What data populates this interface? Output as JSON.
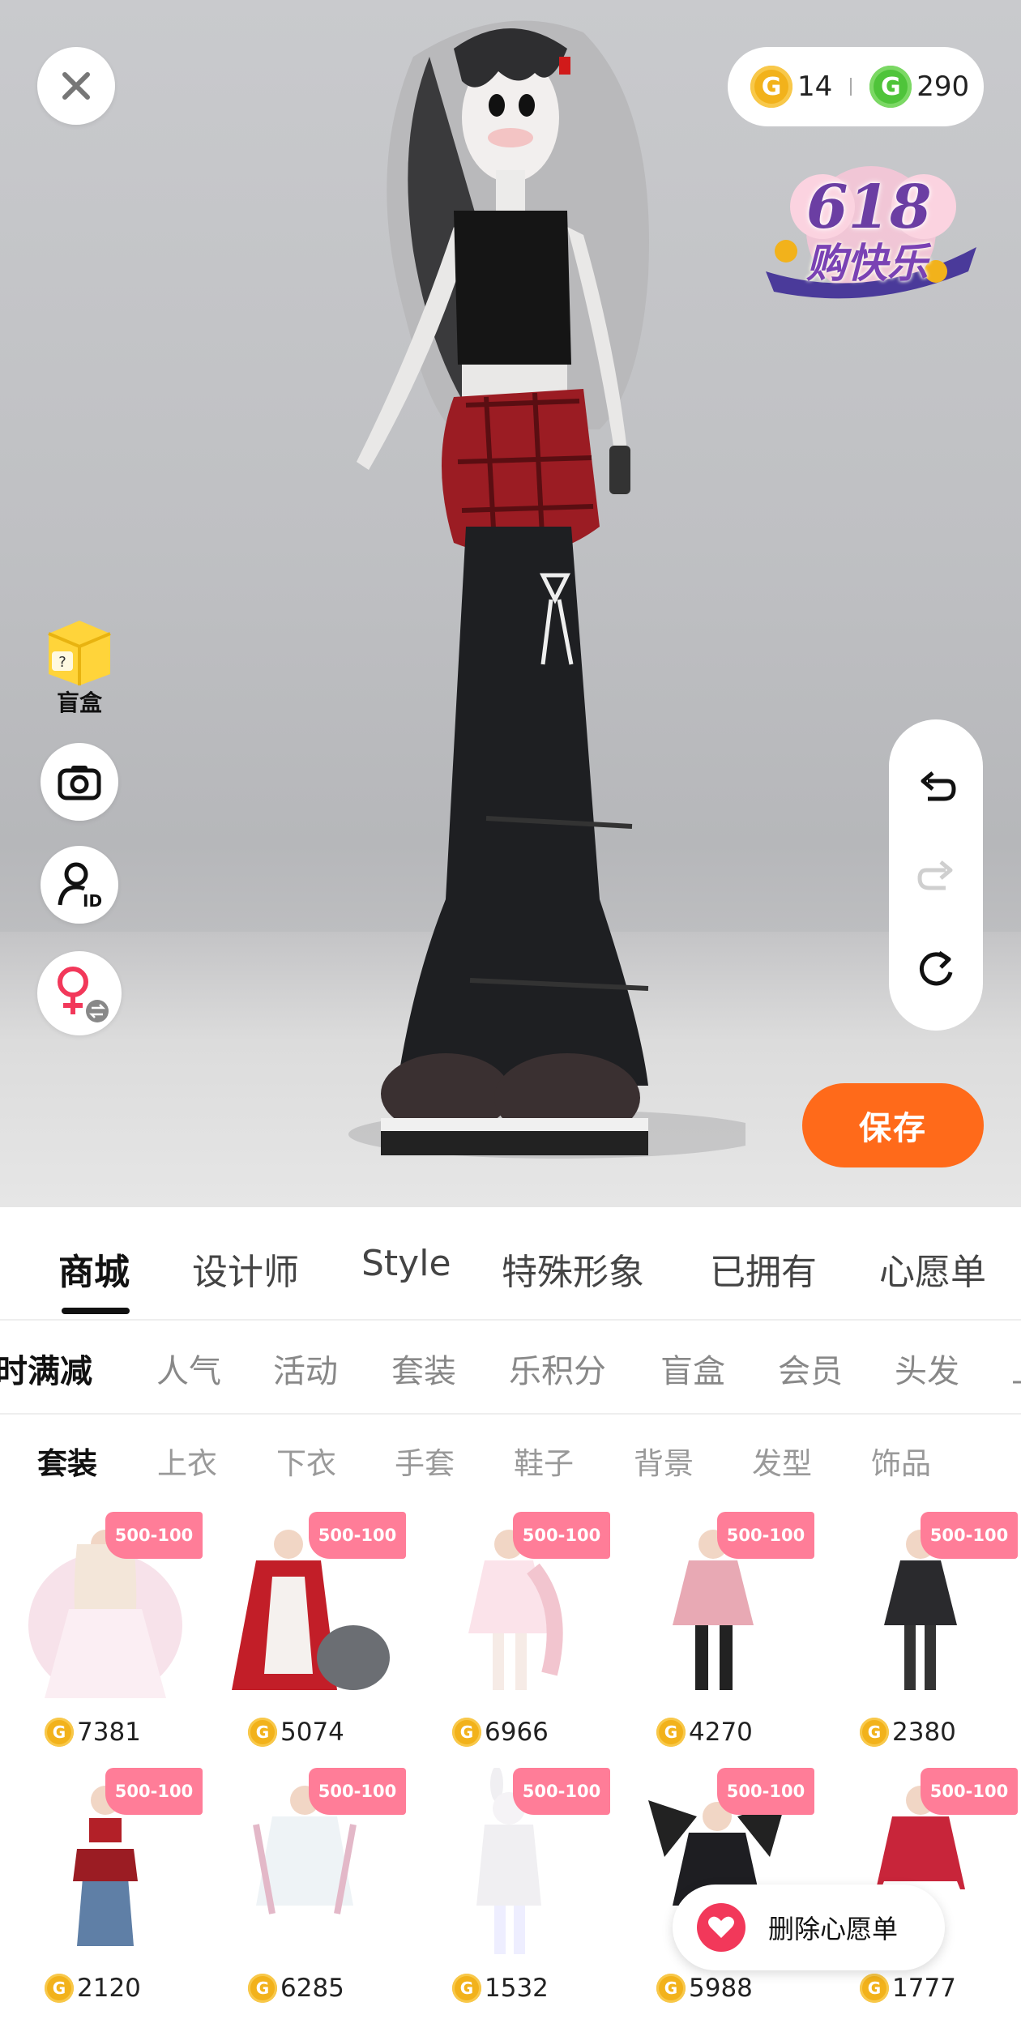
{
  "currency": {
    "gold_icon": "gold-g-coin-icon",
    "gold_amount": "14",
    "green_icon": "green-g-coin-icon",
    "green_amount": "290"
  },
  "promo": {
    "number": "618",
    "text": "购快乐"
  },
  "side_tools": {
    "blind_box_label": "盲盒",
    "icons": [
      "close-icon",
      "camera-icon",
      "user-id-icon",
      "female-swap-icon"
    ]
  },
  "history": {
    "icons": [
      "undo-icon",
      "redo-icon",
      "reset-icon"
    ]
  },
  "save_label": "保存",
  "main_tabs": [
    "商城",
    "设计师",
    "Style",
    "特殊形象",
    "已拥有",
    "心愿单"
  ],
  "category_tabs": [
    "限时满减",
    "人气",
    "活动",
    "套装",
    "乐积分",
    "盲盒",
    "会员",
    "头发",
    "上"
  ],
  "sub_tabs": [
    "套装",
    "上衣",
    "下衣",
    "手套",
    "鞋子",
    "背景",
    "发型",
    "饰品"
  ],
  "items": [
    {
      "badge": "500-100",
      "price": "7381"
    },
    {
      "badge": "500-100",
      "price": "5074"
    },
    {
      "badge": "500-100",
      "price": "6966"
    },
    {
      "badge": "500-100",
      "price": "4270"
    },
    {
      "badge": "500-100",
      "price": "2380"
    },
    {
      "badge": "500-100",
      "price": "2120"
    },
    {
      "badge": "500-100",
      "price": "6285"
    },
    {
      "badge": "500-100",
      "price": "1532"
    },
    {
      "badge": "500-100",
      "price": "5988"
    },
    {
      "badge": "500-100",
      "price": "1777"
    }
  ],
  "wishlist_action": "删除心愿单",
  "colors": {
    "accent": "#ff6a1a",
    "badge": "#ff7d98",
    "heart": "#f2385a",
    "gold": "#f2b21b",
    "green": "#4fc43a"
  }
}
